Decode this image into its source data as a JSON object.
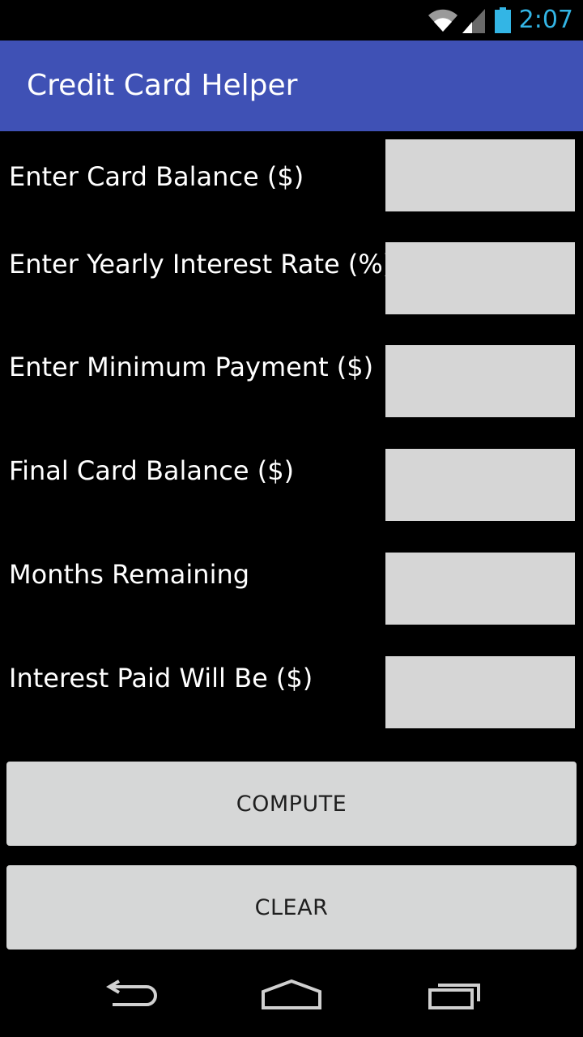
{
  "status_bar": {
    "time": "2:07",
    "icons": [
      "wifi-icon",
      "signal-icon",
      "battery-icon"
    ],
    "clock_color": "#33b5e5"
  },
  "app_bar": {
    "title": "Credit Card Helper",
    "color": "#3f51b5"
  },
  "form": {
    "fields": [
      {
        "label": "Enter Card Balance ($)",
        "value": ""
      },
      {
        "label": "Enter Yearly Interest Rate (%)",
        "value": ""
      },
      {
        "label": "Enter Minimum Payment ($)",
        "value": ""
      },
      {
        "label": "Final Card Balance ($)",
        "value": ""
      },
      {
        "label": "Months Remaining",
        "value": ""
      },
      {
        "label": "Interest Paid Will Be ($)",
        "value": ""
      }
    ]
  },
  "buttons": {
    "compute": "COMPUTE",
    "clear": "CLEAR"
  },
  "nav_bar": {
    "icons": [
      "back-icon",
      "home-icon",
      "recent-apps-icon"
    ]
  }
}
